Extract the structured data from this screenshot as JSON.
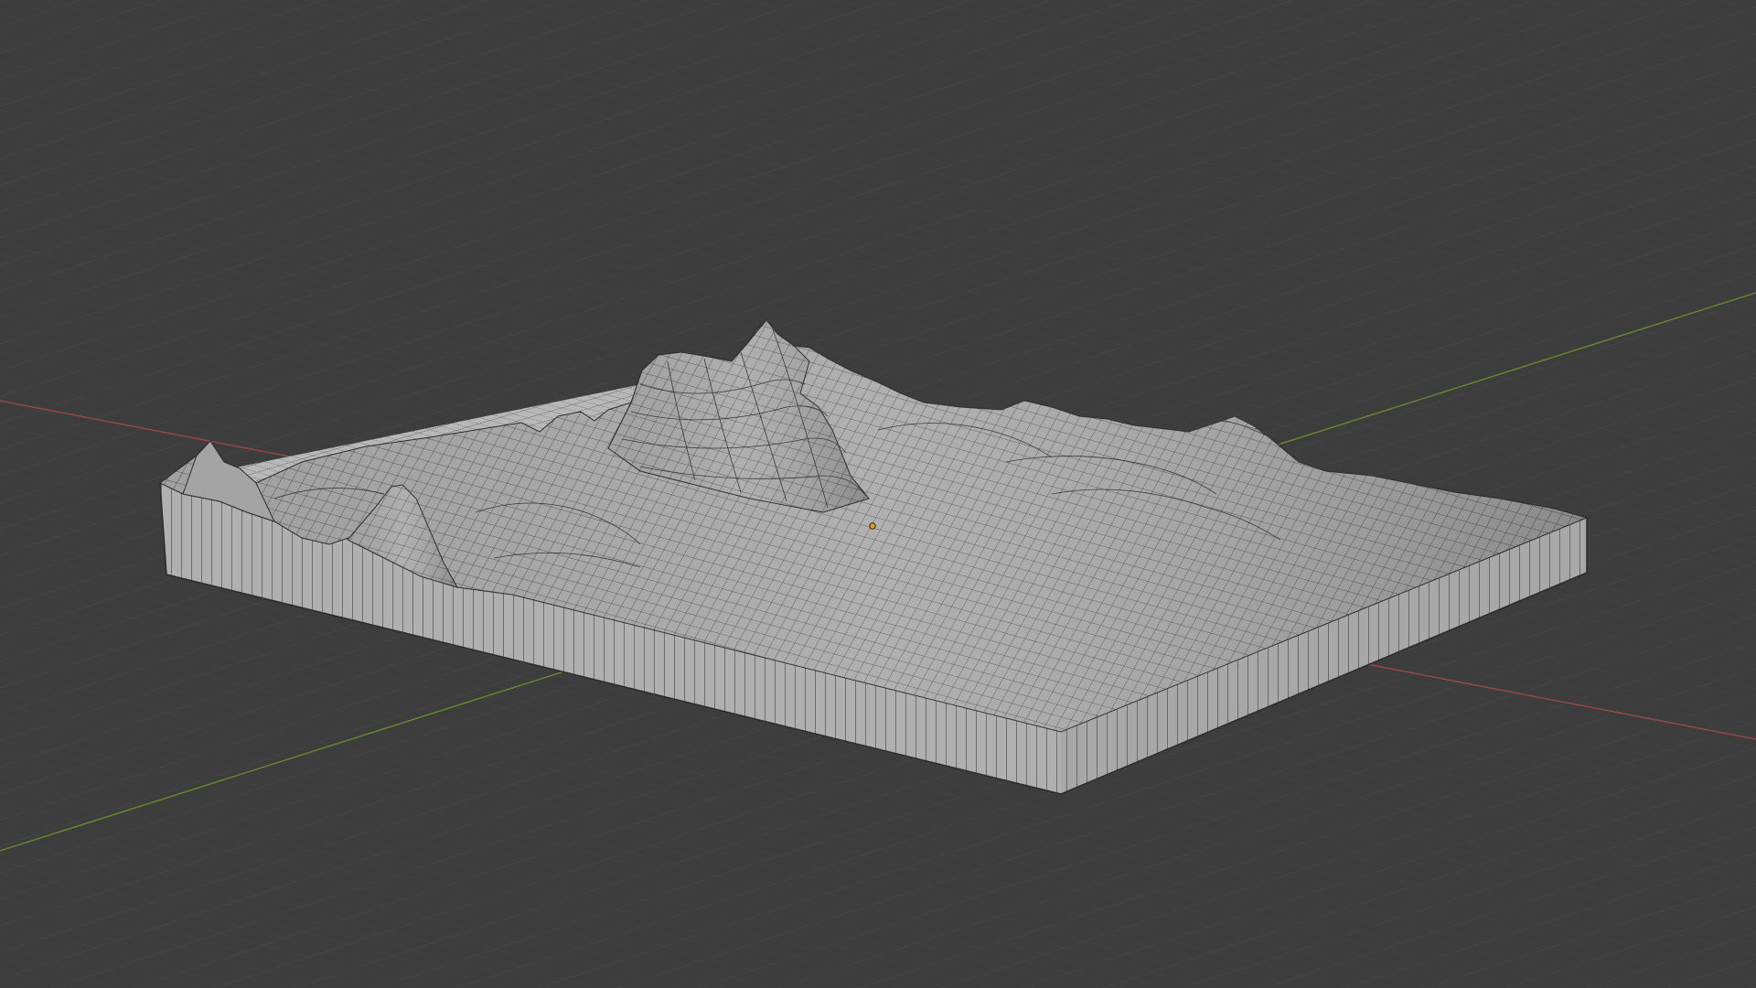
{
  "viewport": {
    "mode": "3d-viewport",
    "shading": "solid",
    "overlay": "wireframe",
    "colors": {
      "background": "#3d3d3d",
      "grid_line": "#4a4a4a",
      "axis_x": "#9a4a4a",
      "axis_y": "#6b8a2e",
      "mesh_fill": "#b4b4b4",
      "mesh_edge": "#2b2b2b",
      "origin": "#e39a1a"
    }
  },
  "scene": {
    "object": {
      "kind": "terrain-mesh",
      "selected": false
    },
    "origin_marker_icon": "origin-dot-icon"
  }
}
